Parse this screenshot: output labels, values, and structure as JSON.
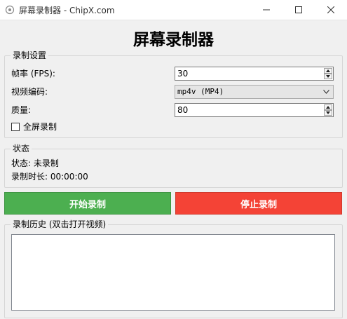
{
  "window": {
    "title": "屏幕录制器 - ChipX.com",
    "minimize_label": "Minimize",
    "maximize_label": "Maximize",
    "close_label": "Close"
  },
  "app": {
    "heading": "屏幕录制器"
  },
  "settings": {
    "legend": "录制设置",
    "fps": {
      "label": "帧率 (FPS):",
      "value": "30"
    },
    "codec": {
      "label": "视频编码:",
      "value": "mp4v (MP4)"
    },
    "quality": {
      "label": "质量:",
      "value": "80"
    },
    "fullscreen": {
      "label": "全屏录制",
      "checked": false
    }
  },
  "status": {
    "legend": "状态",
    "state_text": "状态: 未录制",
    "duration_text": "录制时长: 00:00:00"
  },
  "actions": {
    "start_label": "开始录制",
    "start_color": "#4caf50",
    "stop_label": "停止录制",
    "stop_color": "#f44336"
  },
  "history": {
    "legend": "录制历史 (双击打开视频)",
    "items": []
  }
}
